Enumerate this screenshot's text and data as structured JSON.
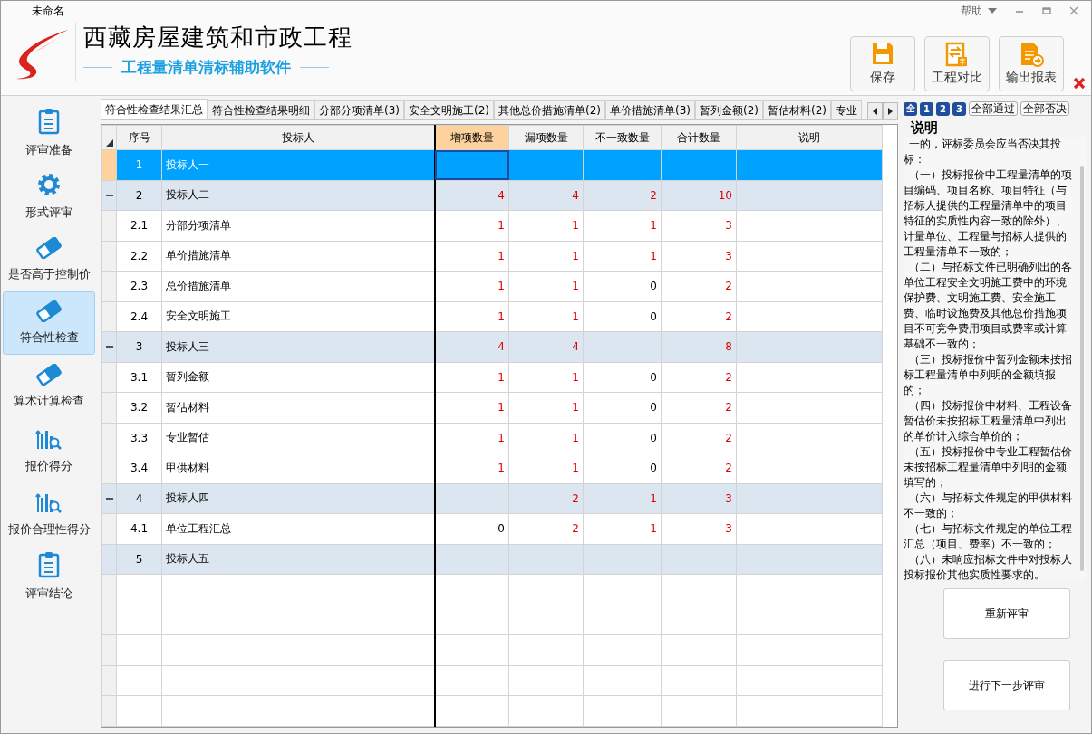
{
  "window": {
    "title": "未命名",
    "help": "帮助"
  },
  "header": {
    "title": "西藏房屋建筑和市政工程",
    "subtitle": "工程量清单清标辅助软件"
  },
  "toolbar": [
    {
      "label": "保存",
      "kind": "save"
    },
    {
      "label": "工程对比",
      "kind": "compare"
    },
    {
      "label": "输出报表",
      "kind": "export"
    }
  ],
  "sidebar": {
    "items": [
      {
        "label": "评审准备",
        "kind": "clipboard",
        "selected": false
      },
      {
        "label": "形式评审",
        "kind": "gear",
        "selected": false
      },
      {
        "label": "是否高于控制价",
        "kind": "eraser",
        "selected": false
      },
      {
        "label": "符合性检查",
        "kind": "eraser",
        "selected": true
      },
      {
        "label": "算术计算检查",
        "kind": "eraser",
        "selected": false
      },
      {
        "label": "报价得分",
        "kind": "chart",
        "selected": false
      },
      {
        "label": "报价合理性得分",
        "kind": "chart",
        "selected": false
      },
      {
        "label": "评审结论",
        "kind": "clipboard",
        "selected": false
      }
    ]
  },
  "tabs": [
    {
      "label": "符合性检查结果汇总",
      "selected": true
    },
    {
      "label": "符合性检查结果明细",
      "selected": false
    },
    {
      "label": "分部分项清单(3)",
      "selected": false
    },
    {
      "label": "安全文明施工(2)",
      "selected": false
    },
    {
      "label": "其他总价措施清单(2)",
      "selected": false
    },
    {
      "label": "单价措施清单(3)",
      "selected": false
    },
    {
      "label": "暂列金额(2)",
      "selected": false
    },
    {
      "label": "暂估材料(2)",
      "selected": false
    },
    {
      "label": "专业",
      "selected": false
    }
  ],
  "table": {
    "columns": [
      {
        "kind": "seq",
        "label": "序号",
        "selected": false
      },
      {
        "kind": "name",
        "label": "投标人",
        "selected": false
      },
      {
        "kind": "added",
        "label": "增项数量",
        "selected": true
      },
      {
        "kind": "missing",
        "label": "漏项数量",
        "selected": false
      },
      {
        "kind": "mismatch",
        "label": "不一致数量",
        "selected": false
      },
      {
        "kind": "total",
        "label": "合计数量",
        "selected": false
      },
      {
        "kind": "note",
        "label": "说明",
        "selected": false
      }
    ],
    "rows": [
      {
        "seq": "1",
        "name": "投标人一",
        "selected": true,
        "expanded": false,
        "cells": {}
      },
      {
        "seq": "2",
        "name": "投标人二",
        "selected": false,
        "expanded": true,
        "cells": {
          "added": {
            "value": "4",
            "flagged": true
          },
          "missing": {
            "value": "4",
            "flagged": true
          },
          "mismatch": {
            "value": "2",
            "flagged": true
          },
          "total": {
            "value": "10",
            "flagged": true
          }
        },
        "children": [
          {
            "seq": "2.1",
            "name": "分部分项清单",
            "selected": false,
            "cells": {
              "added": {
                "value": "1",
                "flagged": true
              },
              "missing": {
                "value": "1",
                "flagged": true
              },
              "mismatch": {
                "value": "1",
                "flagged": true
              },
              "total": {
                "value": "3",
                "flagged": true
              }
            }
          },
          {
            "seq": "2.2",
            "name": "单价措施清单",
            "selected": false,
            "cells": {
              "added": {
                "value": "1",
                "flagged": true
              },
              "missing": {
                "value": "1",
                "flagged": true
              },
              "mismatch": {
                "value": "1",
                "flagged": true
              },
              "total": {
                "value": "3",
                "flagged": true
              }
            }
          },
          {
            "seq": "2.3",
            "name": "总价措施清单",
            "selected": false,
            "cells": {
              "added": {
                "value": "1",
                "flagged": true
              },
              "missing": {
                "value": "1",
                "flagged": true
              },
              "mismatch": {
                "value": "0",
                "flagged": false
              },
              "total": {
                "value": "2",
                "flagged": true
              }
            }
          },
          {
            "seq": "2.4",
            "name": "安全文明施工",
            "selected": false,
            "cells": {
              "added": {
                "value": "1",
                "flagged": true
              },
              "missing": {
                "value": "1",
                "flagged": true
              },
              "mismatch": {
                "value": "0",
                "flagged": false
              },
              "total": {
                "value": "2",
                "flagged": true
              }
            }
          }
        ]
      },
      {
        "seq": "3",
        "name": "投标人三",
        "selected": false,
        "expanded": true,
        "cells": {
          "added": {
            "value": "4",
            "flagged": true
          },
          "missing": {
            "value": "4",
            "flagged": true
          },
          "total": {
            "value": "8",
            "flagged": true
          }
        },
        "children": [
          {
            "seq": "3.1",
            "name": "暂列金额",
            "selected": false,
            "cells": {
              "added": {
                "value": "1",
                "flagged": true
              },
              "missing": {
                "value": "1",
                "flagged": true
              },
              "mismatch": {
                "value": "0",
                "flagged": false
              },
              "total": {
                "value": "2",
                "flagged": true
              }
            }
          },
          {
            "seq": "3.2",
            "name": "暂估材料",
            "selected": false,
            "cells": {
              "added": {
                "value": "1",
                "flagged": true
              },
              "missing": {
                "value": "1",
                "flagged": true
              },
              "mismatch": {
                "value": "0",
                "flagged": false
              },
              "total": {
                "value": "2",
                "flagged": true
              }
            }
          },
          {
            "seq": "3.3",
            "name": "专业暂估",
            "selected": false,
            "cells": {
              "added": {
                "value": "1",
                "flagged": true
              },
              "missing": {
                "value": "1",
                "flagged": true
              },
              "mismatch": {
                "value": "0",
                "flagged": false
              },
              "total": {
                "value": "2",
                "flagged": true
              }
            }
          },
          {
            "seq": "3.4",
            "name": "甲供材料",
            "selected": false,
            "cells": {
              "added": {
                "value": "1",
                "flagged": true
              },
              "missing": {
                "value": "1",
                "flagged": true
              },
              "mismatch": {
                "value": "0",
                "flagged": false
              },
              "total": {
                "value": "2",
                "flagged": true
              }
            }
          }
        ]
      },
      {
        "seq": "4",
        "name": "投标人四",
        "selected": false,
        "expanded": true,
        "cells": {
          "missing": {
            "value": "2",
            "flagged": true
          },
          "mismatch": {
            "value": "1",
            "flagged": true
          },
          "total": {
            "value": "3",
            "flagged": true
          }
        },
        "children": [
          {
            "seq": "4.1",
            "name": "单位工程汇总",
            "selected": false,
            "cells": {
              "added": {
                "value": "0",
                "flagged": false
              },
              "missing": {
                "value": "2",
                "flagged": true
              },
              "mismatch": {
                "value": "1",
                "flagged": true
              },
              "total": {
                "value": "3",
                "flagged": true
              }
            }
          }
        ]
      },
      {
        "seq": "5",
        "name": "投标人五",
        "selected": false,
        "expanded": false,
        "cells": {}
      }
    ]
  },
  "filters": {
    "levels": [
      "全",
      "1",
      "2",
      "3"
    ],
    "buttons": [
      "全部通过",
      "全部否决"
    ]
  },
  "notes": {
    "title": "说明",
    "paragraphs": [
      "一的，评标委员会应当否决其投标：",
      "（一）投标报价中工程量清单的项目编码、项目名称、项目特征（与招标人提供的工程量清单中的项目特征的实质性内容一致的除外）、计量单位、工程量与招标人提供的工程量清单不一致的；",
      "（二）与招标文件已明确列出的各单位工程安全文明施工费中的环境保护费、文明施工费、安全施工费、临时设施费及其他总价措施项目不可竞争费用项目或费率或计算基础不一致的；",
      "（三）投标报价中暂列金额未按招标工程量清单中列明的金额填报的；",
      "（四）投标报价中材料、工程设备暂估价未按招标工程量清单中列出的单价计入综合单价的；",
      "（五）投标报价中专业工程暂估价未按招标工程量清单中列明的金额填写的；",
      "（六）与招标文件规定的甲供材料不一致的；",
      "（七）与招标文件规定的单位工程汇总（项目、费率）不一致的；",
      "（八）未响应招标文件中对投标人投标报价其他实质性要求的。"
    ]
  },
  "actions": [
    "重新评审",
    "进行下一步评审"
  ]
}
